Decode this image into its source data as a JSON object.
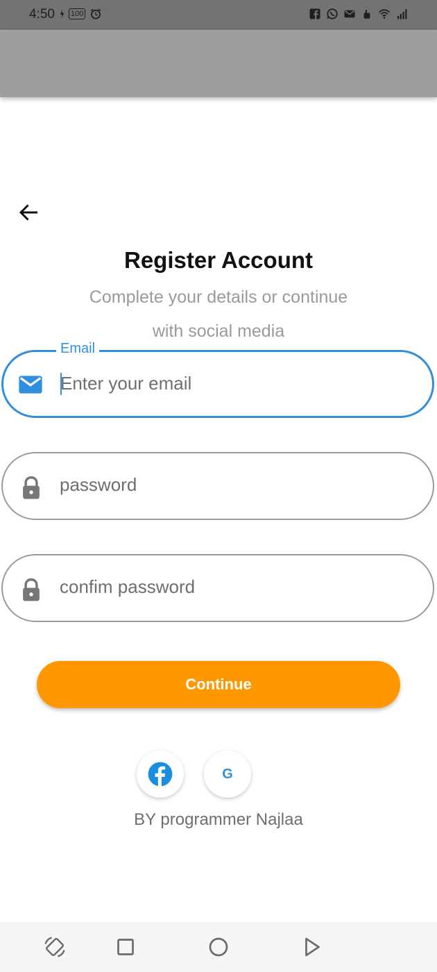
{
  "status_bar": {
    "time": "4:50",
    "battery_level": "100",
    "icons": [
      "facebook-icon",
      "whatsapp-icon",
      "mail-icon",
      "hand-icon",
      "wifi-icon",
      "signal-icon"
    ]
  },
  "form": {
    "title": "Register Account",
    "subtitle_line1": "Complete your details or continue",
    "subtitle_line2": "with social media",
    "email": {
      "label": "Email",
      "value": "",
      "placeholder": "Enter your email",
      "icon": "mail-icon"
    },
    "password": {
      "value": "",
      "placeholder": "password",
      "icon": "lock-icon"
    },
    "confirm_password": {
      "value": "",
      "placeholder": "confim password",
      "icon": "lock-icon"
    },
    "continue_label": "Continue"
  },
  "social": {
    "facebook_icon": "facebook-icon",
    "google_label": "G"
  },
  "credit": "BY programmer Najlaa",
  "colors": {
    "accent": "#2f8fdd",
    "button": "#ff9800",
    "app_bar": "#9e9e9e",
    "status_bar": "#737373"
  }
}
